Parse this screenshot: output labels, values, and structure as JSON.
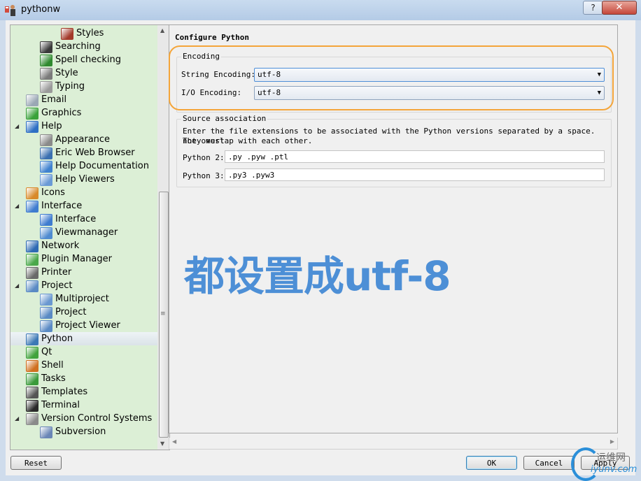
{
  "window": {
    "title": "pythonw",
    "help_glyph": "?",
    "close_glyph": "✕"
  },
  "tree": {
    "items": [
      {
        "label": "Styles",
        "icon": "styles-icon",
        "color": "#a33a2a"
      },
      {
        "label": "Searching",
        "icon": "binoculars-icon",
        "color": "#3a3a3a"
      },
      {
        "label": "Spell checking",
        "icon": "spellcheck-icon",
        "color": "#2f8a2f"
      },
      {
        "label": "Style",
        "icon": "style-icon",
        "color": "#7a7a7a"
      },
      {
        "label": "Typing",
        "icon": "typing-icon",
        "color": "#9a9a9a"
      },
      {
        "label": "Email",
        "icon": "email-icon",
        "color": "#9aa7b4"
      },
      {
        "label": "Graphics",
        "icon": "graphics-icon",
        "color": "#3aa23a"
      },
      {
        "label": "Help",
        "icon": "help-icon",
        "color": "#2e6fc4"
      },
      {
        "label": "Appearance",
        "icon": "appearance-icon",
        "color": "#8a8a8a"
      },
      {
        "label": "Eric Web Browser",
        "icon": "web-browser-icon",
        "color": "#3a6fb0"
      },
      {
        "label": "Help Documentation",
        "icon": "help-documentation-icon",
        "color": "#3f82cf"
      },
      {
        "label": "Help Viewers",
        "icon": "help-viewers-icon",
        "color": "#6a9ad6"
      },
      {
        "label": "Icons",
        "icon": "icons-icon",
        "color": "#d88a2a"
      },
      {
        "label": "Interface",
        "icon": "interface-icon",
        "color": "#3f7ccf"
      },
      {
        "label": "Interface",
        "icon": "interface-icon",
        "color": "#3f7ccf"
      },
      {
        "label": "Viewmanager",
        "icon": "viewmanager-icon",
        "color": "#4f8bd0"
      },
      {
        "label": "Network",
        "icon": "network-icon",
        "color": "#2e6ab3"
      },
      {
        "label": "Plugin Manager",
        "icon": "plugin-manager-icon",
        "color": "#4aa84a"
      },
      {
        "label": "Printer",
        "icon": "printer-icon",
        "color": "#6a6a6a"
      },
      {
        "label": "Project",
        "icon": "project-icon",
        "color": "#5a8ac4"
      },
      {
        "label": "Multiproject",
        "icon": "multiproject-icon",
        "color": "#6a98d0"
      },
      {
        "label": "Project",
        "icon": "project-icon",
        "color": "#5a8ac4"
      },
      {
        "label": "Project Viewer",
        "icon": "project-viewer-icon",
        "color": "#5a8ac4"
      },
      {
        "label": "Python",
        "icon": "python-icon",
        "color": "#3c78b5"
      },
      {
        "label": "Qt",
        "icon": "qt-icon",
        "color": "#41a33c"
      },
      {
        "label": "Shell",
        "icon": "shell-icon",
        "color": "#d07020"
      },
      {
        "label": "Tasks",
        "icon": "tasks-icon",
        "color": "#3a9a3a"
      },
      {
        "label": "Templates",
        "icon": "templates-icon",
        "color": "#555555"
      },
      {
        "label": "Terminal",
        "icon": "terminal-icon",
        "color": "#2a2a2a"
      },
      {
        "label": "Version Control Systems",
        "icon": "vcs-icon",
        "color": "#8a8a8a"
      },
      {
        "label": "Subversion",
        "icon": "subversion-icon",
        "color": "#6a86b6"
      }
    ],
    "expander_expanded": "◢",
    "selected_label": "Python"
  },
  "panel": {
    "title": "Configure Python",
    "encoding": {
      "group_title": "Encoding",
      "string_label": "String Encoding:",
      "string_value": "utf-8",
      "io_label": "I/O Encoding:",
      "io_value": "utf-8",
      "dropdown_glyph": "▼"
    },
    "source": {
      "group_title": "Source association",
      "description_line1": "Enter the file extensions to be associated with the Python versions separated by a space. They must",
      "description_line2": "not overlap with each other.",
      "py2_label": "Python 2:",
      "py2_value": ".py .pyw .ptl",
      "py3_label": "Python 3:",
      "py3_value": ".py3 .pyw3"
    }
  },
  "annotation": {
    "text": "都设置成utf-8",
    "color": "#4d8fd6",
    "highlight_color": "#f4a53a"
  },
  "buttons": {
    "reset": "Reset",
    "ok": "OK",
    "cancel": "Cancel",
    "apply": "Apply"
  },
  "watermark": {
    "line1": "运维网",
    "line2": "iyunv.com"
  }
}
